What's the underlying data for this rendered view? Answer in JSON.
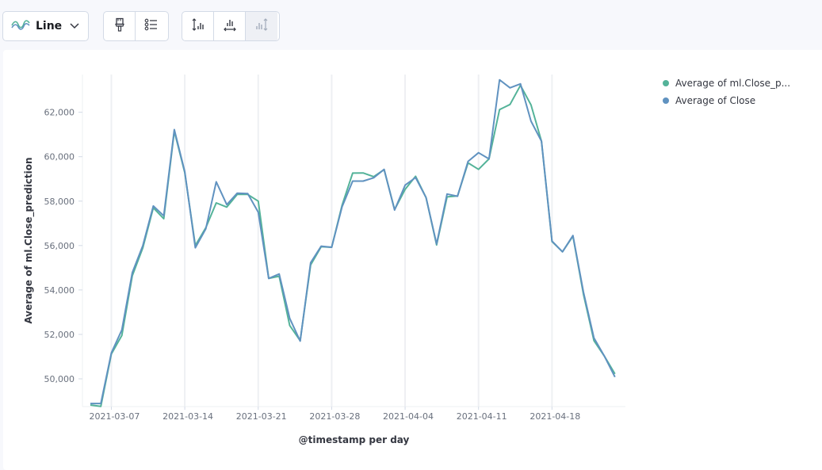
{
  "toolbar": {
    "chart_type_label": "Line",
    "buttons": [
      "paintbrush-icon",
      "list-settings-icon",
      "left-axis-icon",
      "bottom-axis-icon",
      "right-axis-icon"
    ]
  },
  "colors": {
    "series1": "#54b399",
    "series2": "#6092c0",
    "grid": "#eef0f3",
    "axis_text": "#69707d"
  },
  "chart_data": {
    "type": "line",
    "xlabel": "@timestamp per day",
    "ylabel": "Average of ml.Close_prediction",
    "x_ticks": [
      "2021-03-07",
      "2021-03-14",
      "2021-03-21",
      "2021-03-28",
      "2021-04-04",
      "2021-04-11",
      "2021-04-18"
    ],
    "y_ticks": [
      "50,000",
      "52,000",
      "54,000",
      "56,000",
      "58,000",
      "60,000",
      "62,000"
    ],
    "ylim": [
      48750,
      63700
    ],
    "x": [
      "2021-03-05",
      "2021-03-06",
      "2021-03-07",
      "2021-03-08",
      "2021-03-09",
      "2021-03-10",
      "2021-03-11",
      "2021-03-12",
      "2021-03-13",
      "2021-03-14",
      "2021-03-15",
      "2021-03-16",
      "2021-03-17",
      "2021-03-18",
      "2021-03-19",
      "2021-03-20",
      "2021-03-21",
      "2021-03-22",
      "2021-03-23",
      "2021-03-24",
      "2021-03-25",
      "2021-03-26",
      "2021-03-27",
      "2021-03-28",
      "2021-03-29",
      "2021-03-30",
      "2021-03-31",
      "2021-04-01",
      "2021-04-02",
      "2021-04-03",
      "2021-04-04",
      "2021-04-05",
      "2021-04-06",
      "2021-04-07",
      "2021-04-08",
      "2021-04-09",
      "2021-04-10",
      "2021-04-11",
      "2021-04-12",
      "2021-04-13",
      "2021-04-14",
      "2021-04-15",
      "2021-04-16",
      "2021-04-17",
      "2021-04-18",
      "2021-04-19",
      "2021-04-20",
      "2021-04-21",
      "2021-04-22",
      "2021-04-23",
      "2021-04-24",
      "2021-04-25"
    ],
    "series": [
      {
        "name": "Average of ml.Close_prediction",
        "color": "#54b399",
        "values": [
          48820,
          48760,
          51120,
          51950,
          54640,
          55900,
          57700,
          57210,
          61150,
          59280,
          56000,
          56800,
          57920,
          57730,
          58300,
          58300,
          58000,
          54520,
          54620,
          52400,
          51720,
          55130,
          55950,
          55920,
          57820,
          59260,
          59270,
          59100,
          59420,
          57620,
          58530,
          59120,
          58160,
          56030,
          58190,
          58230,
          59720,
          59430,
          59900,
          62120,
          62350,
          63210,
          62330,
          60700,
          56180,
          55720,
          56420,
          53800,
          51720,
          51020,
          50220
        ]
      },
      {
        "name": "Average of Close",
        "color": "#6092c0",
        "values": [
          48890,
          48890,
          51170,
          52200,
          54780,
          56000,
          57780,
          57340,
          61220,
          59330,
          55900,
          56750,
          58870,
          57840,
          58360,
          58340,
          57500,
          54520,
          54720,
          52720,
          51700,
          55230,
          55970,
          55920,
          57750,
          58900,
          58900,
          59050,
          59430,
          57600,
          58720,
          59060,
          58160,
          56070,
          58320,
          58220,
          59790,
          60180,
          59900,
          63460,
          63100,
          63280,
          61600,
          60700,
          56200,
          55720,
          56450,
          53900,
          51840,
          51020,
          50080
        ]
      }
    ],
    "legend_position": "top-right",
    "grid": "vertical"
  }
}
